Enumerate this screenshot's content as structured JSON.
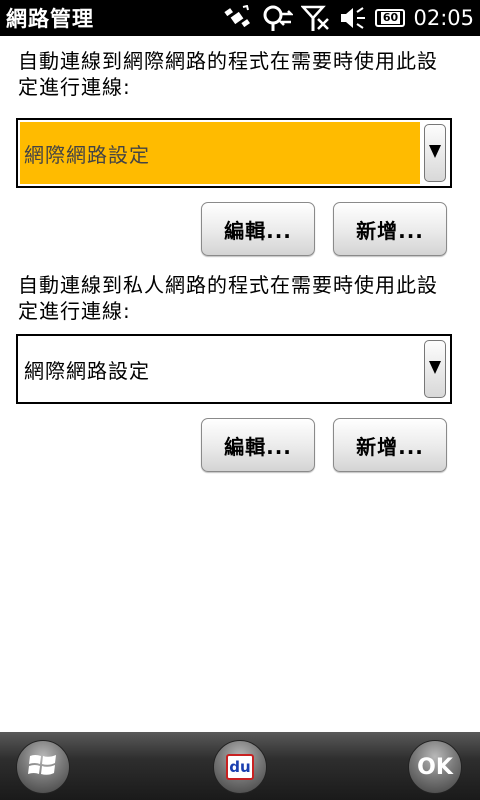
{
  "app": {
    "title": "網路管理"
  },
  "status_bar": {
    "time": "02:05",
    "battery_label": "60",
    "icons": [
      "satellite-icon",
      "gps-sync-icon",
      "no-signal-icon",
      "volume-icon",
      "battery-icon"
    ]
  },
  "internet_section": {
    "label": "自動連線到網際網路的程式在需要時使用此設定進行連線:",
    "selected_value": "網際網路設定",
    "edit_label": "編輯...",
    "new_label": "新增..."
  },
  "private_section": {
    "label": "自動連線到私人網路的程式在需要時使用此設定進行連線:",
    "selected_value": "網際網路設定",
    "edit_label": "編輯...",
    "new_label": "新增..."
  },
  "bottom_bar": {
    "ok_label": "OK",
    "center_app_label": "du"
  },
  "colors": {
    "selection": "#ffbb00",
    "titlebar": "#000000",
    "accent_red": "#d02020",
    "accent_blue": "#1a3fb0"
  }
}
